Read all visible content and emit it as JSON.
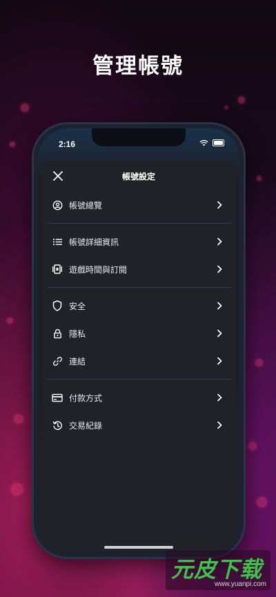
{
  "hero": {
    "title": "管理帳號"
  },
  "status_bar": {
    "time": "2:16"
  },
  "panel": {
    "title": "帳號設定",
    "groups": [
      [
        {
          "label": "帳號總覽",
          "icon": "account-circle-icon"
        }
      ],
      [
        {
          "label": "帳號詳細資訊",
          "icon": "list-icon"
        },
        {
          "label": "遊戲時間與訂閱",
          "icon": "media-icon"
        }
      ],
      [
        {
          "label": "安全",
          "icon": "shield-icon"
        },
        {
          "label": "隱私",
          "icon": "lock-icon"
        },
        {
          "label": "連結",
          "icon": "link-icon"
        }
      ],
      [
        {
          "label": "付款方式",
          "icon": "credit-card-icon"
        },
        {
          "label": "交易紀錄",
          "icon": "history-icon"
        }
      ]
    ]
  },
  "colors": {
    "panel_bg": "#202227",
    "text": "#e9eaee",
    "divider": "#3a3d45",
    "watermark_green": "#3ec24a"
  },
  "watermark": {
    "main": "元皮下载",
    "url": "www.yuanpi.com"
  }
}
